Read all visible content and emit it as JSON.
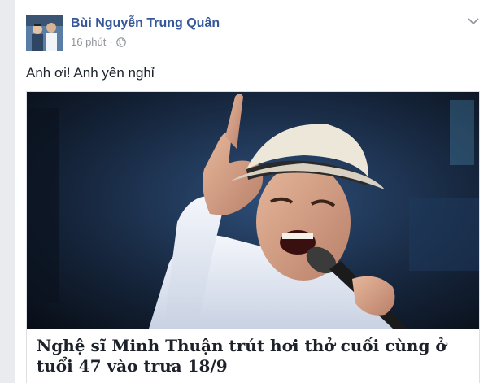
{
  "post": {
    "author": "Bùi Nguyễn Trung Quân",
    "timestamp": "16 phút",
    "separator": "·",
    "privacy_icon": "globe-icon",
    "menu_icon": "chevron-down-icon",
    "text": "Anh ơi! Anh yên nghỉ",
    "link": {
      "image_icon": "singer-photo",
      "title": "Nghệ sĩ Minh Thuận trút hơi thở cuối cùng ở tuổi 47 vào trưa 18/9"
    }
  },
  "colors": {
    "author_link": "#365899",
    "meta_gray": "#90949c",
    "text": "#1d2129",
    "background": "#e9ebee"
  }
}
